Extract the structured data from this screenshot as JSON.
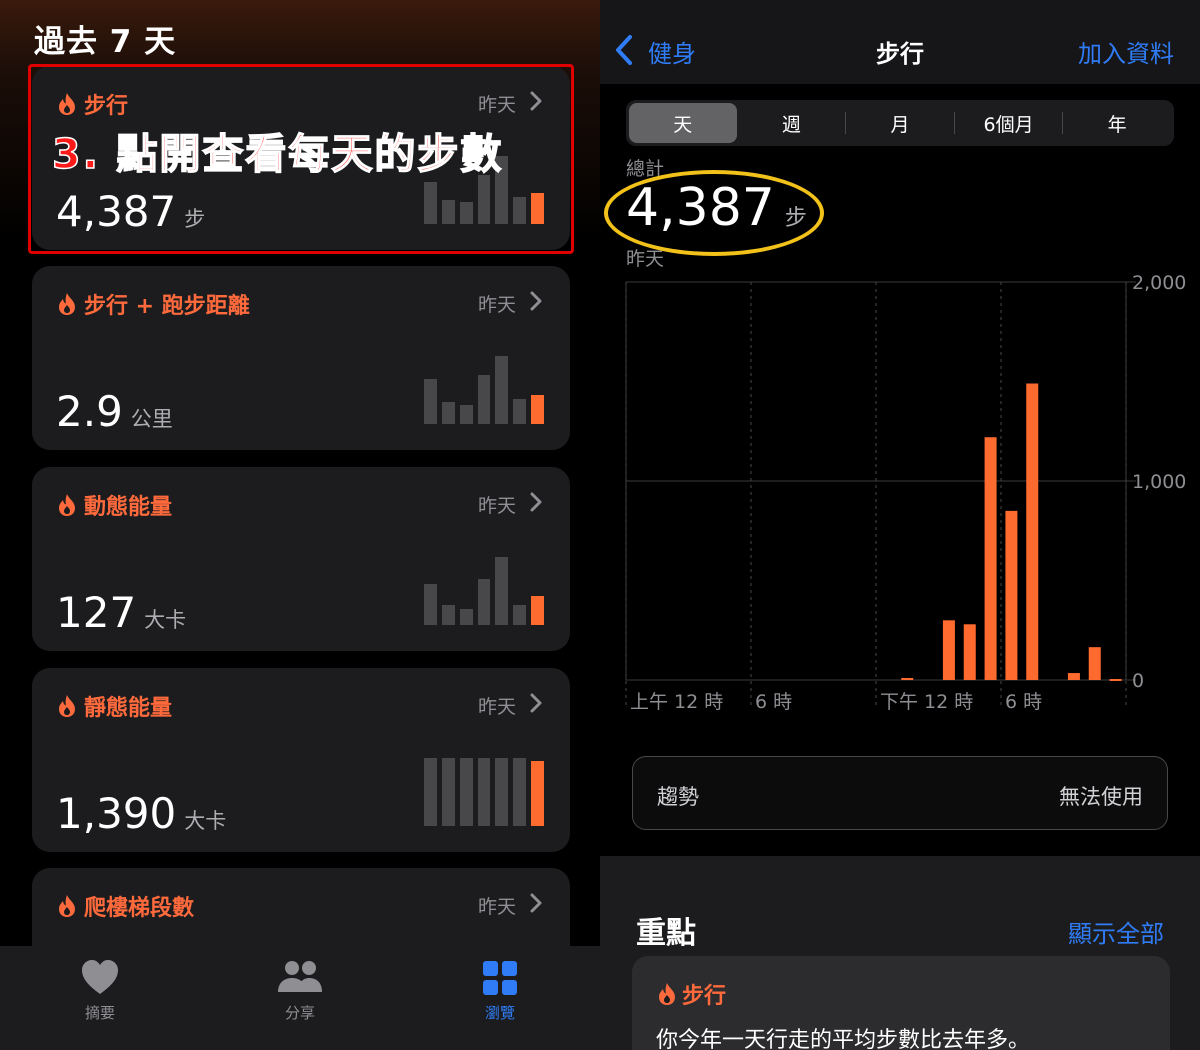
{
  "left": {
    "section_title": "過去 7 天",
    "annotation": "3. 點開查看每天的步數",
    "cards": [
      {
        "title": "步行",
        "date": "昨天",
        "value": "4,387",
        "unit": "步",
        "bars": [
          0.62,
          0.35,
          0.32,
          0.72,
          1.0,
          0.4,
          0.46
        ],
        "icon": "flame-icon"
      },
      {
        "title": "步行 + 跑步距離",
        "date": "昨天",
        "value": "2.9",
        "unit": "公里",
        "bars": [
          0.66,
          0.33,
          0.28,
          0.72,
          1.0,
          0.37,
          0.42
        ],
        "icon": "flame-icon"
      },
      {
        "title": "動態能量",
        "date": "昨天",
        "value": "127",
        "unit": "大卡",
        "bars": [
          0.6,
          0.3,
          0.24,
          0.68,
          1.0,
          0.3,
          0.42
        ],
        "icon": "flame-icon"
      },
      {
        "title": "靜態能量",
        "date": "昨天",
        "value": "1,390",
        "unit": "大卡",
        "bars": [
          1.0,
          1.0,
          1.0,
          1.0,
          1.0,
          1.0,
          0.95
        ],
        "icon": "flame-icon"
      },
      {
        "title": "爬樓梯段數",
        "date": "昨天",
        "value": "",
        "unit": "",
        "bars": [],
        "icon": "flame-icon"
      }
    ],
    "tabbar": [
      {
        "label": "摘要",
        "icon": "heart-icon",
        "active": false
      },
      {
        "label": "分享",
        "icon": "people-icon",
        "active": false
      },
      {
        "label": "瀏覽",
        "icon": "grid-icon",
        "active": true
      }
    ]
  },
  "right": {
    "nav": {
      "back_label": "健身",
      "title": "步行",
      "add_label": "加入資料"
    },
    "segments": [
      "天",
      "週",
      "月",
      "6個月",
      "年"
    ],
    "selected_segment": "天",
    "total_label": "總計",
    "total_value": "4,387",
    "total_unit": "步",
    "date_label": "昨天",
    "trend_label": "趨勢",
    "trend_value": "無法使用",
    "highlights_title": "重點",
    "highlights_all": "顯示全部",
    "highlight_card_title": "步行",
    "highlight_card_text": "你今年一天行走的平均步數比去年多。"
  },
  "colors": {
    "accent": "#ff6a2e",
    "link": "#2f7cf6",
    "annotation_red": "#ff1a1a",
    "circle_yellow": "#f2c21b"
  },
  "chart_data": {
    "type": "bar",
    "title": "",
    "xlabel": "",
    "ylabel": "",
    "ylim": [
      0,
      2000
    ],
    "yticks": [
      "2,000",
      "1,000",
      "0"
    ],
    "ytick_values": [
      2000,
      1000,
      0
    ],
    "xtick_labels": [
      "上午 12 時",
      "6 時",
      "下午 12 時",
      "6 時"
    ],
    "xtick_hours": [
      0,
      6,
      12,
      18
    ],
    "grid": true,
    "series": [
      {
        "hours": [
          13,
          15,
          16,
          17,
          18,
          19,
          21,
          22,
          23
        ],
        "values": [
          10,
          300,
          280,
          1220,
          850,
          1490,
          35,
          165,
          5
        ]
      }
    ]
  }
}
